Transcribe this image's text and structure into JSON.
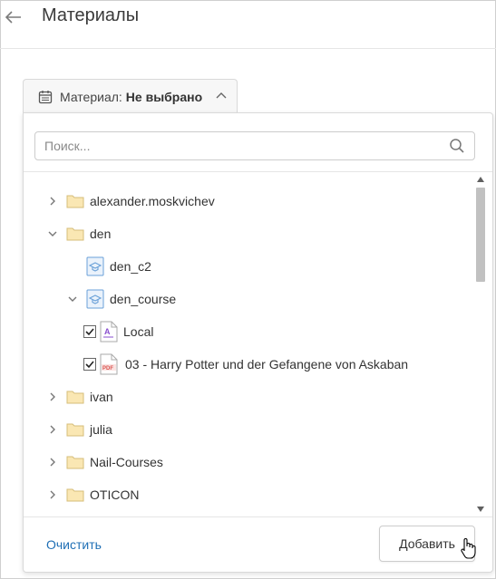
{
  "header": {
    "title": "Материалы",
    "back_icon": "arrow-left-icon"
  },
  "selector": {
    "label": "Материал:",
    "value": "Не выбрано",
    "icon": "calendar-icon",
    "chevron": "chevron-up-icon"
  },
  "search": {
    "placeholder": "Поиск...",
    "value": ""
  },
  "tree": {
    "items": [
      {
        "label": "alexander.moskvichev",
        "type": "folder",
        "expanded": false
      },
      {
        "label": "den",
        "type": "folder",
        "expanded": true
      },
      {
        "label": "den_c2",
        "type": "course"
      },
      {
        "label": "den_course",
        "type": "course",
        "expanded": true
      },
      {
        "label": "Local",
        "type": "file-text",
        "checked": true
      },
      {
        "label": "03 - Harry Potter und der Gefangene von Askaban",
        "type": "file-pdf",
        "checked": true
      },
      {
        "label": "ivan",
        "type": "folder",
        "expanded": false
      },
      {
        "label": "julia",
        "type": "folder",
        "expanded": false
      },
      {
        "label": "Nail-Courses",
        "type": "folder",
        "expanded": false
      },
      {
        "label": "OTICON",
        "type": "folder",
        "expanded": false
      }
    ]
  },
  "footer": {
    "clear_label": "Очистить",
    "add_label": "Добавить"
  },
  "colors": {
    "accent": "#1f6fb5",
    "folder": "#fae7b3",
    "course": "#6aa0d8",
    "pdf": "#d9534f"
  }
}
